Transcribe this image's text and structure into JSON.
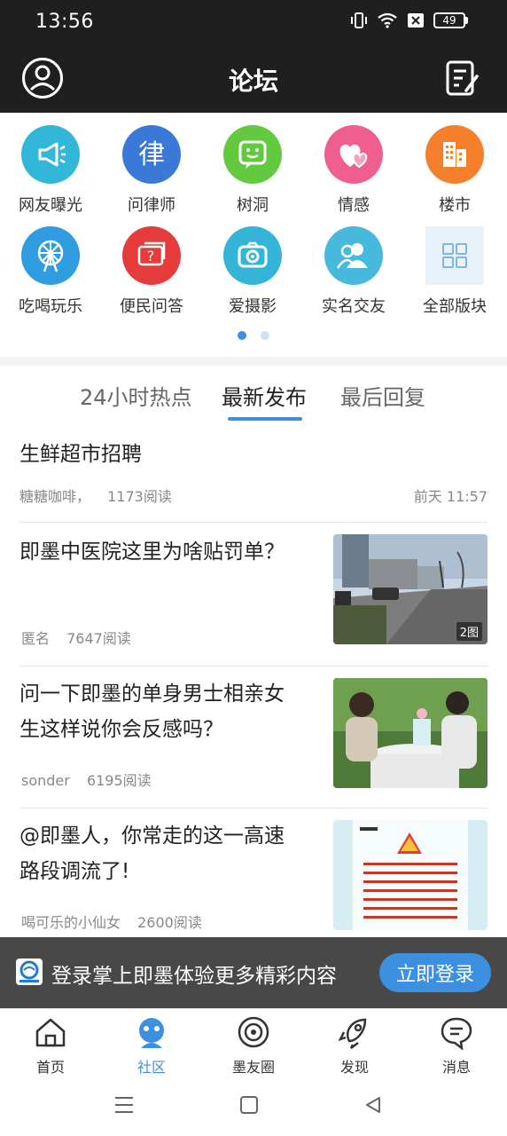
{
  "status": {
    "time": "13:56",
    "battery": "49"
  },
  "header": {
    "title": "论坛"
  },
  "categories": [
    {
      "label": "网友曝光",
      "icon": "megaphone-icon",
      "color": "#33b7d9"
    },
    {
      "label": "问律师",
      "icon": "law-icon",
      "color": "#3b79d9"
    },
    {
      "label": "树洞",
      "icon": "chat-face-icon",
      "color": "#63c93f"
    },
    {
      "label": "情感",
      "icon": "hearts-icon",
      "color": "#ee5f8f"
    },
    {
      "label": "楼市",
      "icon": "building-icon",
      "color": "#f5802b"
    },
    {
      "label": "吃喝玩乐",
      "icon": "ferris-wheel-icon",
      "color": "#2f9ddf"
    },
    {
      "label": "便民问答",
      "icon": "question-chat-icon",
      "color": "#e53b3b"
    },
    {
      "label": "爱摄影",
      "icon": "camera-icon",
      "color": "#34b5d7"
    },
    {
      "label": "实名交友",
      "icon": "people-icon",
      "color": "#47b9dd"
    },
    {
      "label": "全部版块",
      "icon": "grid-icon",
      "color": "#e8f2f8"
    }
  ],
  "tabs": {
    "hot": "24小时热点",
    "latest": "最新发布",
    "last_reply": "最后回复"
  },
  "posts": [
    {
      "title": "生鲜超市招聘",
      "author": "糖糖咖啡，",
      "reads": "1173阅读",
      "time": "前天 11:57"
    },
    {
      "title": "即墨中医院这里为啥贴罚单？",
      "author": "匿名",
      "reads": "7647阅读",
      "badge": "2图"
    },
    {
      "title_line1": "问一下即墨的单身男士相亲女",
      "title_line2": "生这样说你会反感吗？",
      "author": "sonder",
      "reads": "6195阅读"
    },
    {
      "title_line1": "@即墨人，你常走的这一高速",
      "title_line2": "路段调流了!",
      "author": "喝可乐的小仙女",
      "reads": "2600阅读"
    }
  ],
  "login": {
    "text": "登录掌上即墨体验更多精彩内容",
    "button": "立即登录"
  },
  "nav": {
    "home": "首页",
    "community": "社区",
    "circle": "墨友圈",
    "discover": "发现",
    "messages": "消息"
  }
}
